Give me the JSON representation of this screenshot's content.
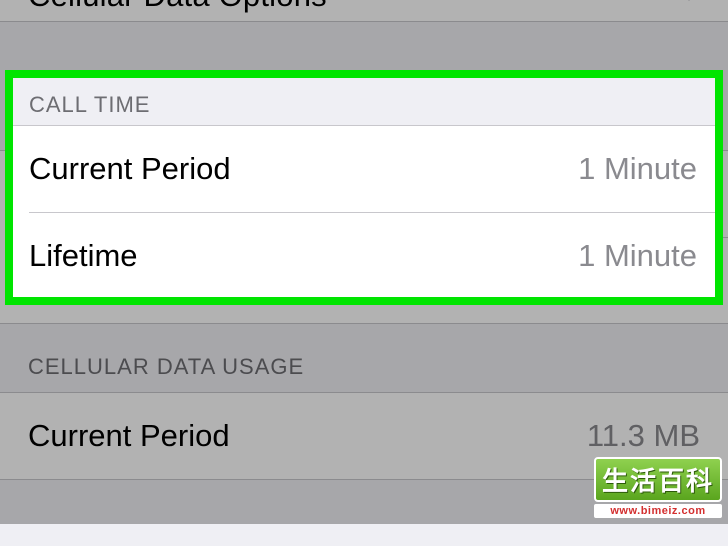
{
  "top_row": {
    "label": "Cellular Data Options"
  },
  "sections": {
    "call_time": {
      "header": "CALL TIME",
      "rows": [
        {
          "label": "Current Period",
          "value": "1 Minute"
        },
        {
          "label": "Lifetime",
          "value": "1 Minute"
        }
      ]
    },
    "data_usage": {
      "header": "CELLULAR DATA USAGE",
      "rows": [
        {
          "label": "Current Period",
          "value": "11.3 MB"
        }
      ]
    }
  },
  "watermark": {
    "text": "生活百科",
    "url": "www.bimeiz.com"
  }
}
